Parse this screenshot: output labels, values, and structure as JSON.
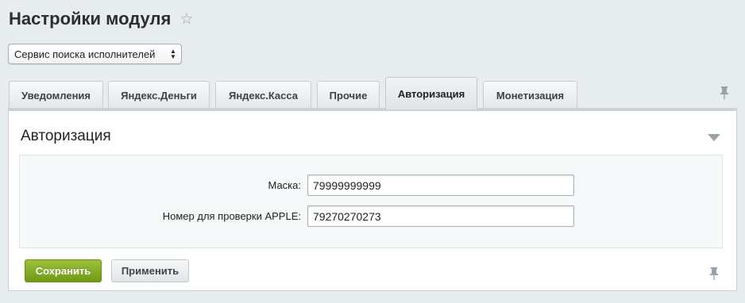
{
  "page": {
    "title": "Настройки модуля"
  },
  "module_select": {
    "value": "Сервис поиска исполнителей"
  },
  "tabs": [
    {
      "label": "Уведомления",
      "active": false
    },
    {
      "label": "Яндекс.Деньги",
      "active": false
    },
    {
      "label": "Яндекс.Касса",
      "active": false
    },
    {
      "label": "Прочие",
      "active": false
    },
    {
      "label": "Авторизация",
      "active": true
    },
    {
      "label": "Монетизация",
      "active": false
    }
  ],
  "section": {
    "title": "Авторизация"
  },
  "fields": [
    {
      "label": "Маска:",
      "value": "79999999999"
    },
    {
      "label": "Номер для проверки APPLE:",
      "value": "79270270273"
    }
  ],
  "buttons": {
    "save_label": "Сохранить",
    "apply_label": "Применить"
  },
  "icons": {
    "favorite": "star-icon",
    "pin": "pin-icon",
    "collapse": "collapse-arrow-icon"
  },
  "colors": {
    "save_button": "#7ea82a",
    "background": "#e7ecee"
  }
}
